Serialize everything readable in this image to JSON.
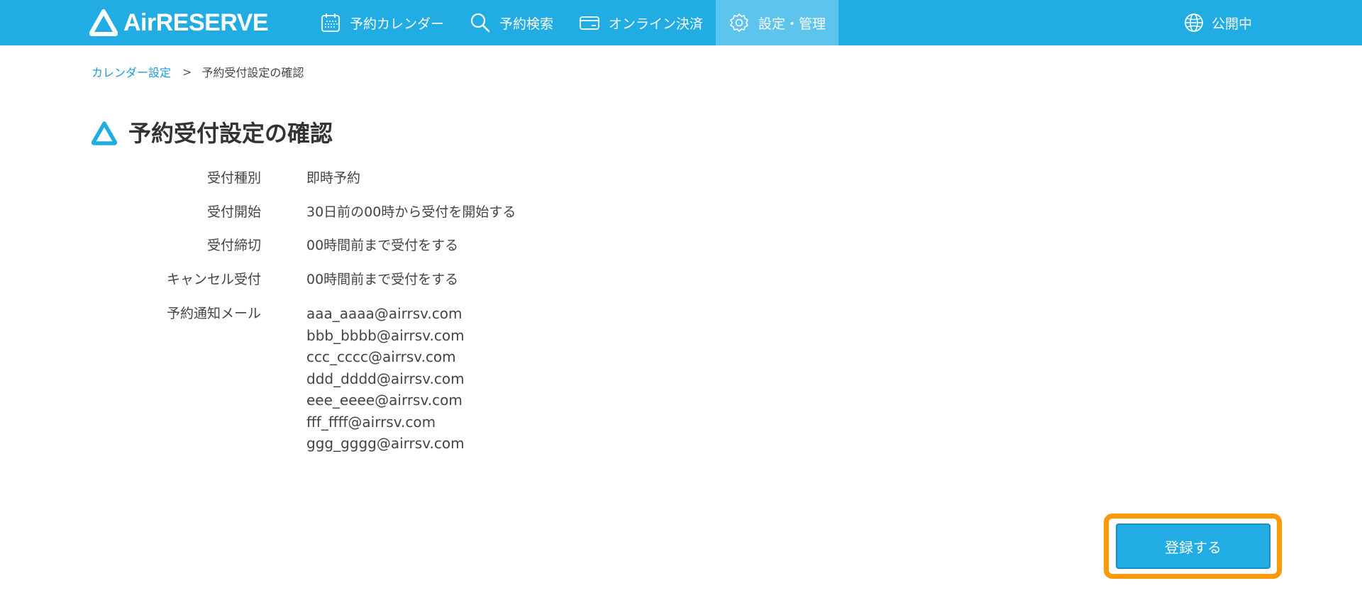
{
  "header": {
    "brand": "AirRESERVE",
    "nav": [
      {
        "label": "予約カレンダー",
        "icon": "calendar-icon"
      },
      {
        "label": "予約検索",
        "icon": "search-icon"
      },
      {
        "label": "オンライン決済",
        "icon": "credit-card-icon"
      },
      {
        "label": "設定・管理",
        "icon": "gear-icon",
        "active": true
      }
    ],
    "status": {
      "label": "公開中",
      "icon": "globe-icon"
    }
  },
  "breadcrumb": {
    "parent": "カレンダー設定",
    "separator": ">",
    "current": "予約受付設定の確認"
  },
  "page": {
    "title": "予約受付設定の確認",
    "title_icon": "triangle-logo-icon"
  },
  "settings": {
    "type": {
      "label": "受付種別",
      "value": "即時予約"
    },
    "start": {
      "label": "受付開始",
      "value": "30日前の00時から受付を開始する"
    },
    "deadline": {
      "label": "受付締切",
      "value": "00時間前まで受付をする"
    },
    "cancel": {
      "label": "キャンセル受付",
      "value": "00時間前まで受付をする"
    },
    "notification": {
      "label": "予約通知メール",
      "emails": [
        "aaa_aaaa@airrsv.com",
        "bbb_bbbb@airrsv.com",
        "ccc_cccc@airrsv.com",
        "ddd_dddd@airrsv.com",
        "eee_eeee@airrsv.com",
        "fff_ffff@airrsv.com",
        "ggg_gggg@airrsv.com"
      ]
    }
  },
  "actions": {
    "register_label": "登録する"
  },
  "colors": {
    "header_bg": "#21ace3",
    "nav_active_bg": "#5dc4ee",
    "link": "#1a9bd7",
    "button_bg": "#21ace3",
    "highlight": "#fb9a06"
  }
}
